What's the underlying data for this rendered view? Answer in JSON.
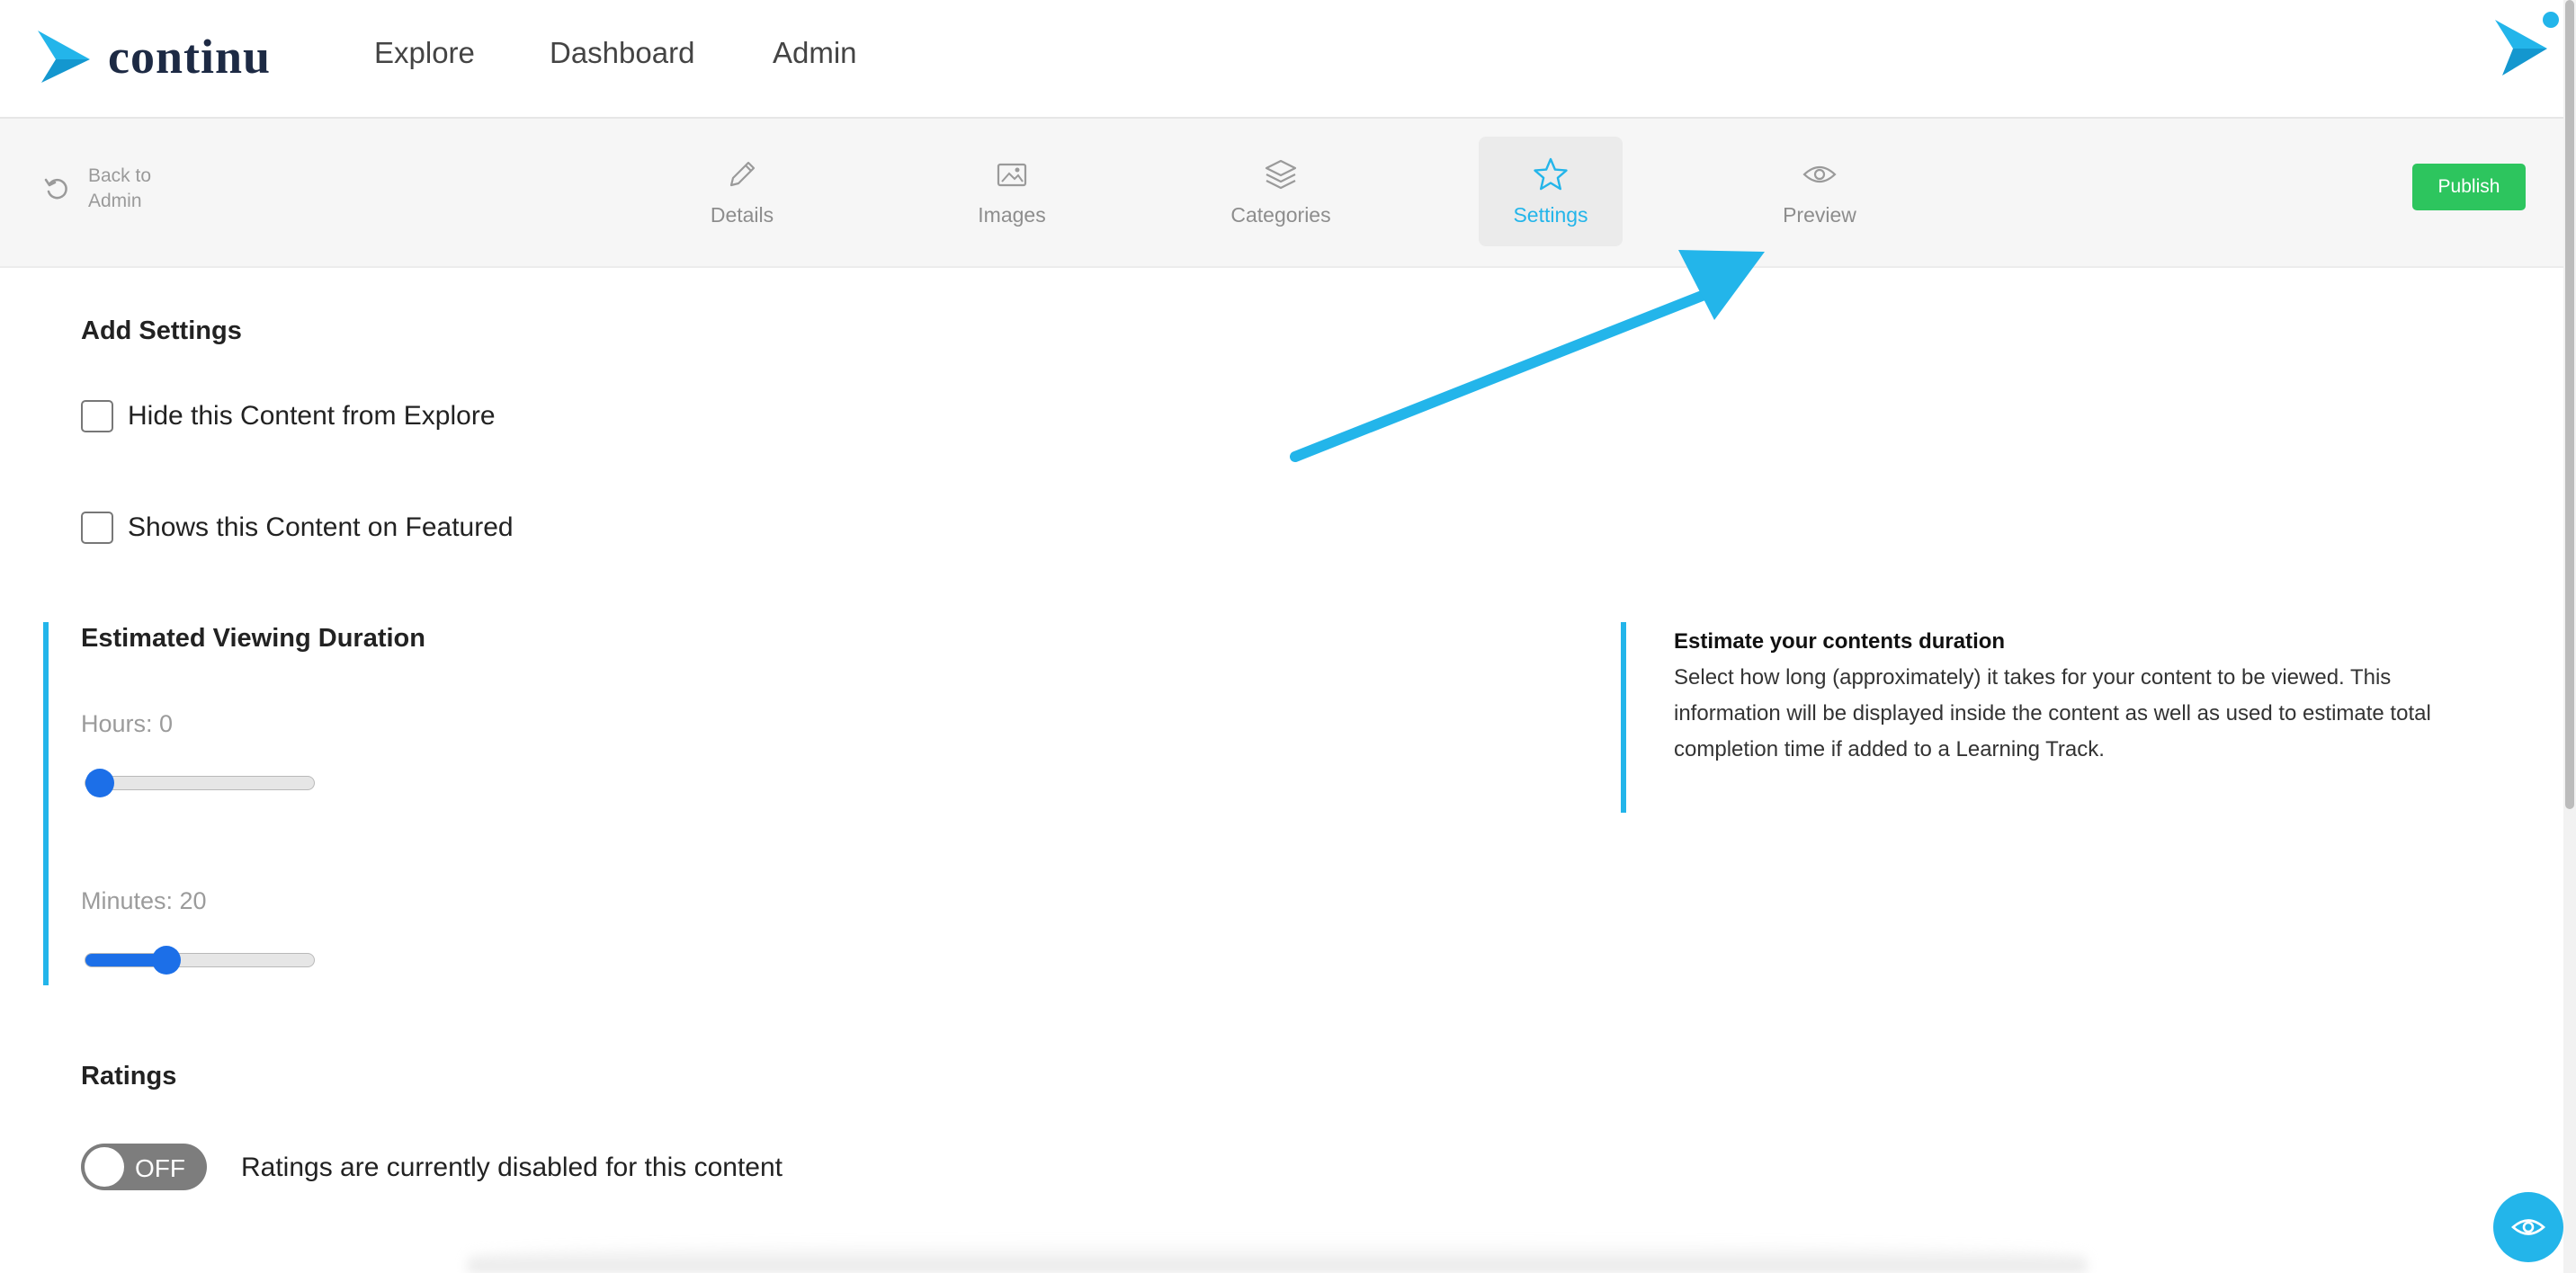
{
  "brand": {
    "name": "continu",
    "accent_color": "#23b5ea"
  },
  "topnav": {
    "links": [
      {
        "label": "Explore"
      },
      {
        "label": "Dashboard"
      },
      {
        "label": "Admin"
      }
    ]
  },
  "toolbar": {
    "back_label": "Back to Admin",
    "tabs": [
      {
        "label": "Details",
        "icon": "pencil-icon",
        "active": false
      },
      {
        "label": "Images",
        "icon": "image-icon",
        "active": false
      },
      {
        "label": "Categories",
        "icon": "layers-icon",
        "active": false
      },
      {
        "label": "Settings",
        "icon": "star-icon",
        "active": true
      },
      {
        "label": "Preview",
        "icon": "eye-icon",
        "active": false
      }
    ],
    "publish_label": "Publish",
    "publish_color": "#2dc55e"
  },
  "settings": {
    "heading": "Add Settings",
    "checkboxes": [
      {
        "label": "Hide this Content from Explore",
        "checked": false
      },
      {
        "label": "Shows this Content on Featured",
        "checked": false
      }
    ]
  },
  "duration": {
    "heading": "Estimated Viewing Duration",
    "hours_label": "Hours: 0",
    "hours_fraction": 0.0,
    "minutes_label": "Minutes: 20",
    "minutes_fraction": 0.33,
    "info_title": "Estimate your contents duration",
    "info_text": "Select how long (approximately) it takes for your content to be viewed. This information will be displayed inside the content as well as used to estimate total completion time if added to a Learning Track."
  },
  "ratings": {
    "heading": "Ratings",
    "toggle_state": "OFF",
    "caption": "Ratings are currently disabled for this content"
  }
}
